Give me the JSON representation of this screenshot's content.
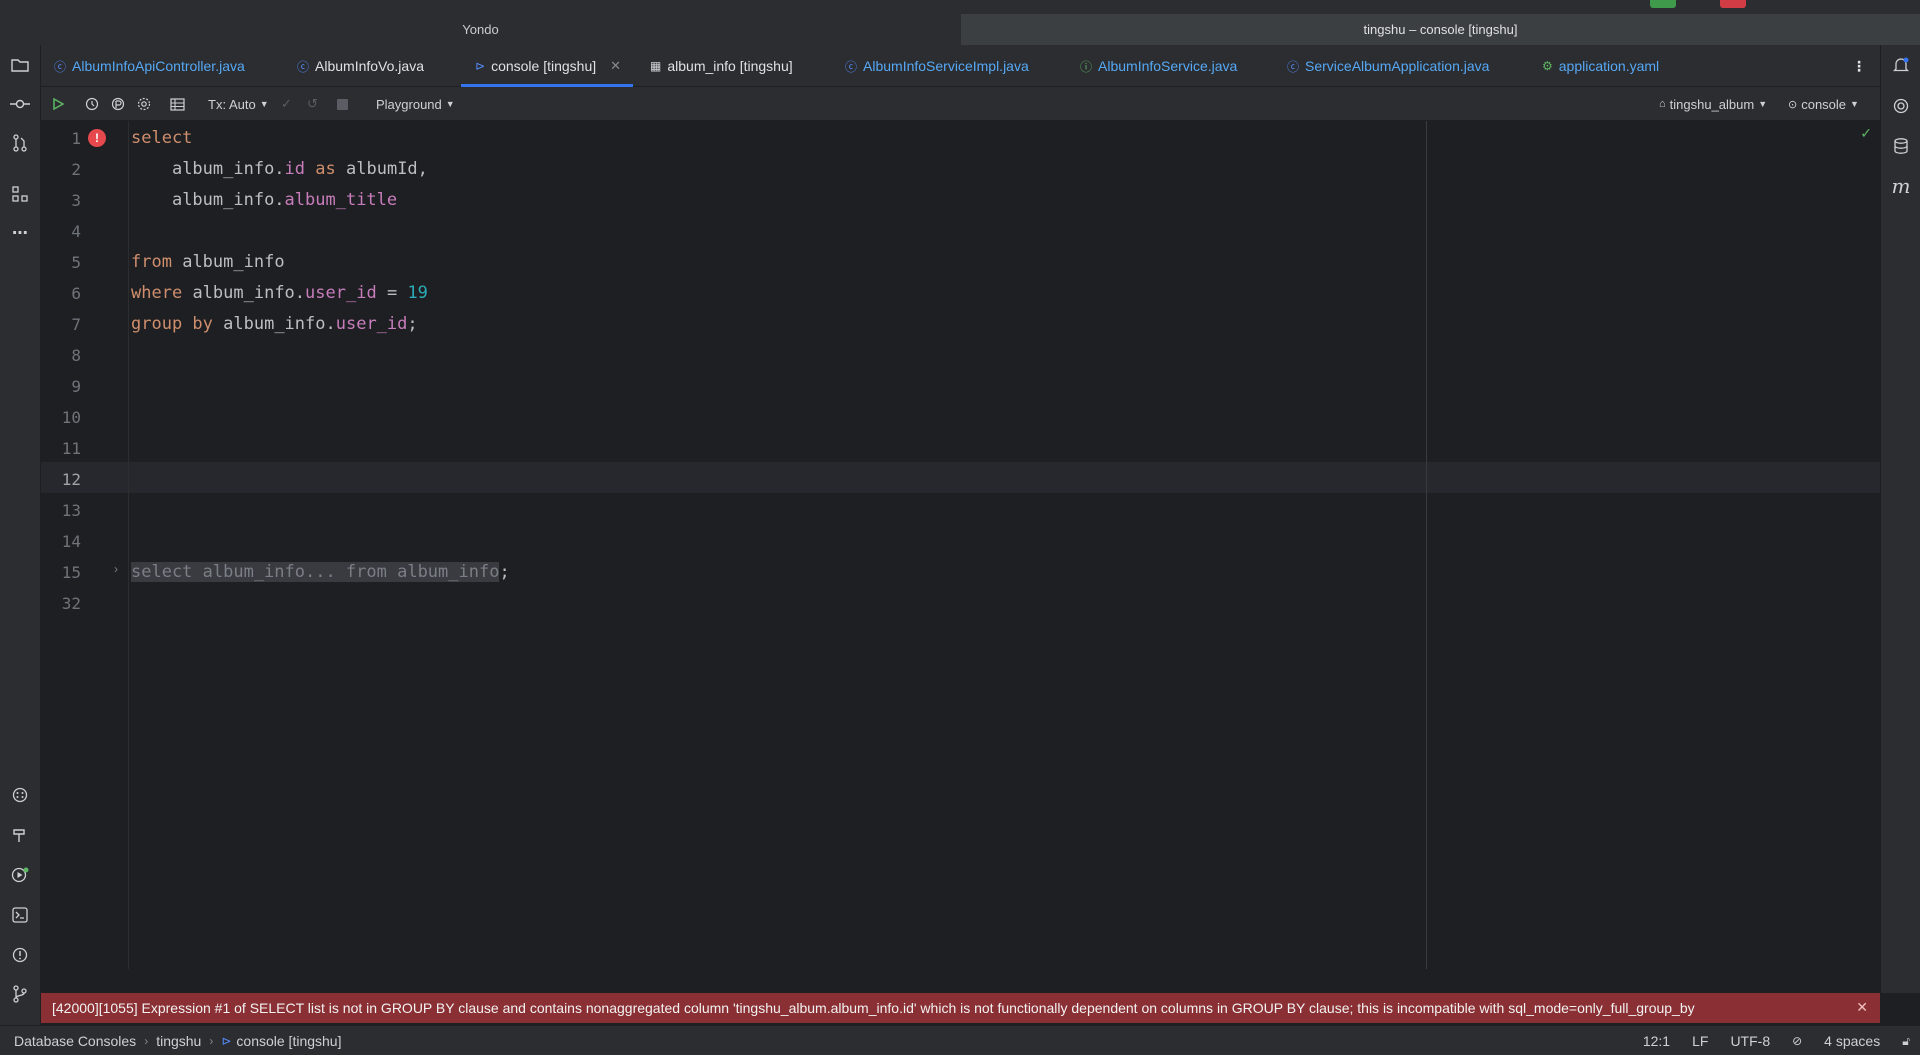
{
  "window": {
    "left_title": "Yondo",
    "right_title": "tingshu – console [tingshu]"
  },
  "tabs": [
    {
      "label": "AlbumInfoApiController.java",
      "icon": "class-icon"
    },
    {
      "label": "AlbumInfoVo.java",
      "icon": "class-icon"
    },
    {
      "label": "console [tingshu]",
      "icon": "console-icon",
      "active": true
    },
    {
      "label": "album_info [tingshu]",
      "icon": "table-icon"
    },
    {
      "label": "AlbumInfoServiceImpl.java",
      "icon": "class-icon"
    },
    {
      "label": "AlbumInfoService.java",
      "icon": "interface-icon"
    },
    {
      "label": "ServiceAlbumApplication.java",
      "icon": "spring-class-icon"
    },
    {
      "label": "application.yaml",
      "icon": "yaml-icon"
    }
  ],
  "toolbar": {
    "tx_label": "Tx: Auto",
    "playground_label": "Playground",
    "schema_label": "tingshu_album",
    "console_label": "console"
  },
  "editor": {
    "line_numbers": [
      "1",
      "2",
      "3",
      "4",
      "5",
      "6",
      "7",
      "8",
      "9",
      "10",
      "11",
      "12",
      "13",
      "14",
      "15",
      "32"
    ],
    "lines": {
      "l1_kw": "select",
      "l2_a": "album_info.",
      "l2_b": "id",
      "l2_c": "as",
      "l2_d": "albumId,",
      "l3_a": "album_info.",
      "l3_b": "album_title",
      "l5_kw": "from",
      "l5_a": "album_info",
      "l6_kw": "where",
      "l6_a": "album_info.",
      "l6_b": "user_id",
      "l6_c": "=",
      "l6_num": "19",
      "l7_kw": "group by",
      "l7_a": "album_info.",
      "l7_b": "user_id",
      "l7_c": ";",
      "l15_fold": "select album_info... from album_info",
      "l15_end": ";"
    },
    "error_badge": "!"
  },
  "error_banner": {
    "text": "[42000][1055] Expression #1 of SELECT list is not in GROUP BY clause and contains nonaggregated column 'tingshu_album.album_info.id' which is not functionally dependent on columns in GROUP BY clause; this is incompatible with sql_mode=only_full_group_by"
  },
  "statusbar": {
    "breadcrumbs": [
      "Database Consoles",
      "tingshu",
      "console [tingshu]"
    ],
    "position": "12:1",
    "line_ending": "LF",
    "encoding": "UTF-8",
    "indent": "4 spaces"
  },
  "colors": {
    "accent": "#3574f0",
    "error_banner": "#8a2f33",
    "keyword": "#cf8e6d",
    "field": "#c77dbb",
    "number": "#2aacb8"
  }
}
